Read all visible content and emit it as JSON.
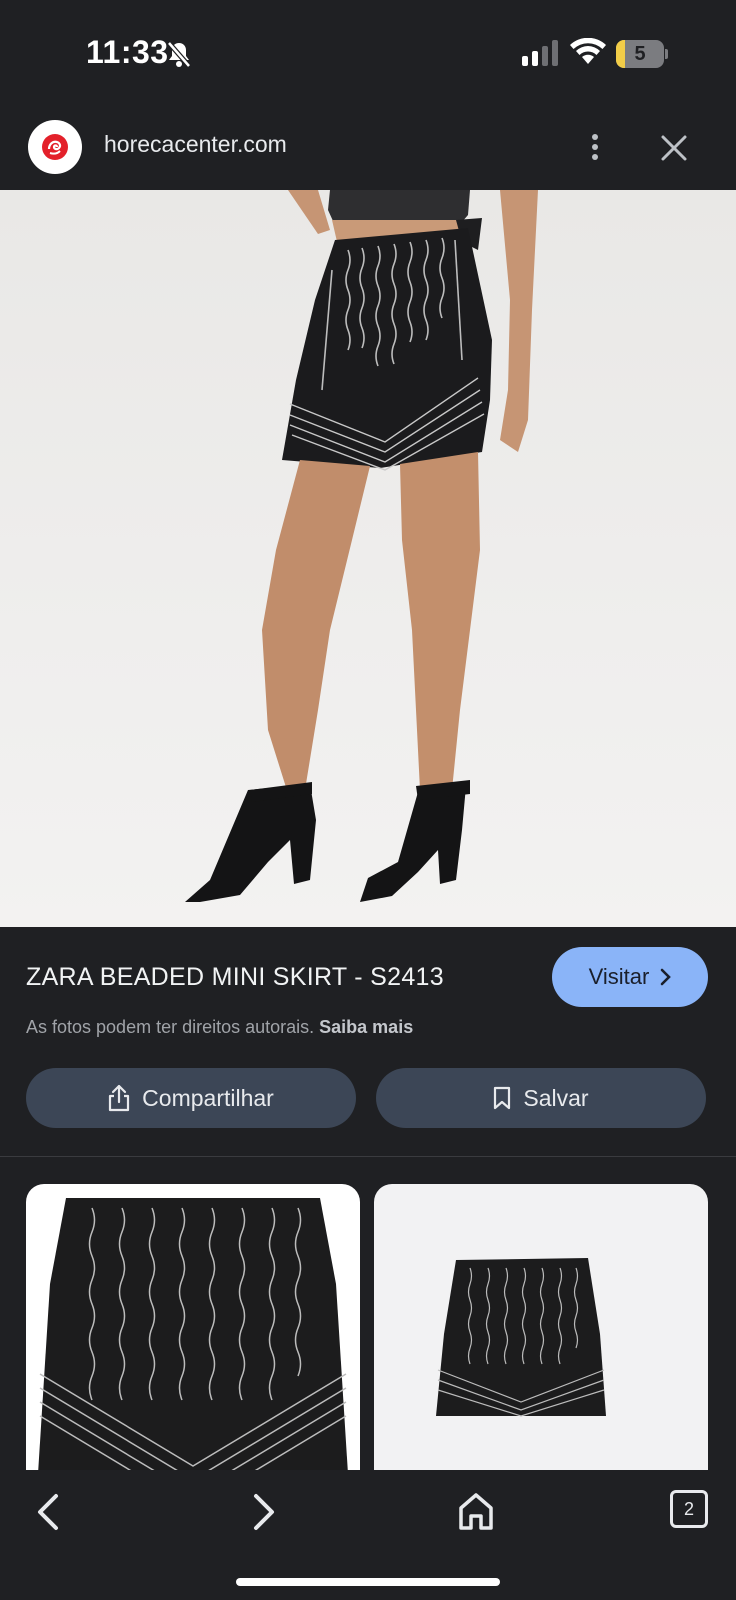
{
  "status_bar": {
    "time": "11:33",
    "battery_level": "5",
    "battery_fraction": 0.05,
    "icons": [
      "bell-slash-icon",
      "cellular-signal-icon",
      "wifi-icon",
      "battery-icon"
    ]
  },
  "browser": {
    "site_url": "horecacenter.com",
    "menu_icon": "more-vert-icon",
    "close_icon": "close-icon"
  },
  "product": {
    "title": "ZARA BEADED MINI SKIRT - S2413",
    "visit_label": "Visitar",
    "copyright_text": "As fotos podem ter direitos autorais.",
    "learn_more": "Saiba mais",
    "share_label": "Compartilhar",
    "save_label": "Salvar"
  },
  "bottom_nav": {
    "tab_count": "2"
  },
  "colors": {
    "background": "#1f2023",
    "visit_button": "#8ab4f8",
    "action_button": "#3c4656"
  }
}
